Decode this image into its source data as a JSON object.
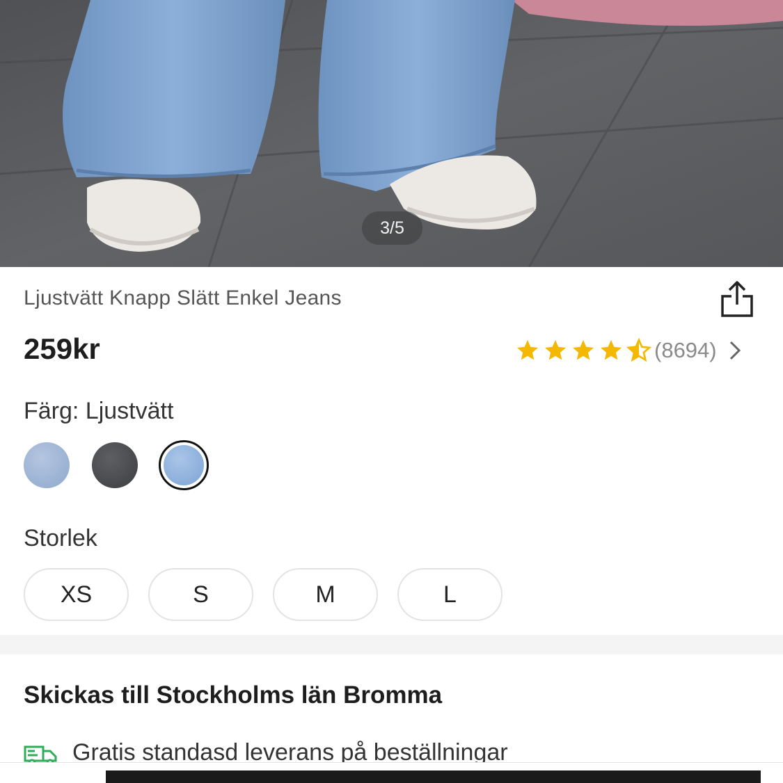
{
  "hero": {
    "image_alt": "model-wearing-light-wash-jeans-and-white-sneakers",
    "pager": "3/5"
  },
  "product": {
    "title": "Ljustvätt Knapp Slätt Enkel Jeans",
    "price": "259kr",
    "rating_value": 4.5,
    "rating_count": "(8694)",
    "star_color": "#F5B800"
  },
  "color": {
    "label": "Färg: Ljustvätt",
    "swatches": [
      {
        "name": "light-blue-denim",
        "color": "#9cb3d3",
        "selected": false
      },
      {
        "name": "dark-grey-denim",
        "color": "#4c4d50",
        "selected": false
      },
      {
        "name": "light-wash-denim",
        "color": "#8fb2dc",
        "selected": true
      }
    ]
  },
  "size": {
    "label": "Storlek",
    "options": [
      "XS",
      "S",
      "M",
      "L"
    ]
  },
  "shipping": {
    "title": "Skickas till Stockholms län Bromma",
    "line": "Gratis standasd leverans på beställningar",
    "icon_color": "#2fae5a"
  }
}
